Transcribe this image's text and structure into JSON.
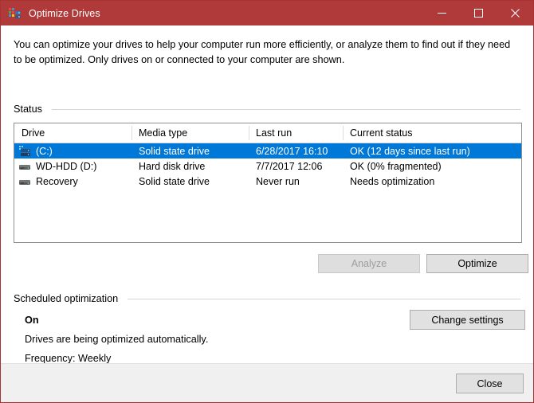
{
  "window": {
    "title": "Optimize Drives",
    "icon": "defragmenter-icon",
    "accent_titlebar": "#b03a3a",
    "selection_color": "#0078d7"
  },
  "caption": {
    "minimize": "—",
    "maximize": "☐",
    "close": "✕"
  },
  "intro": {
    "text": "You can optimize your drives to help your computer run more efficiently, or analyze them to find out if they need to be optimized. Only drives on or connected to your computer are shown."
  },
  "status_group": {
    "label": "Status"
  },
  "table": {
    "columns": [
      "Drive",
      "Media type",
      "Last run",
      "Current status"
    ],
    "rows": [
      {
        "drive": "(C:)",
        "media_type": "Solid state drive",
        "last_run": "6/28/2017 16:10",
        "current_status": "OK (12 days since last run)",
        "icon": "system-drive-icon",
        "selected": true
      },
      {
        "drive": "WD-HDD (D:)",
        "media_type": "Hard disk drive",
        "last_run": "7/7/2017 12:06",
        "current_status": "OK (0% fragmented)",
        "icon": "hard-drive-icon",
        "selected": false
      },
      {
        "drive": "Recovery",
        "media_type": "Solid state drive",
        "last_run": "Never run",
        "current_status": "Needs optimization",
        "icon": "hard-drive-icon",
        "selected": false
      }
    ]
  },
  "actions": {
    "analyze": "Analyze",
    "analyze_enabled": false,
    "optimize": "Optimize"
  },
  "scheduled_group": {
    "label": "Scheduled optimization",
    "state": "On",
    "description": "Drives are being optimized automatically.",
    "frequency": "Frequency: Weekly",
    "change_settings": "Change settings"
  },
  "footer": {
    "close": "Close"
  }
}
